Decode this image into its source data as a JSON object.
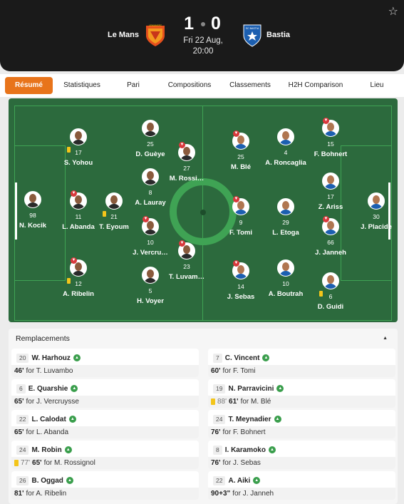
{
  "header": {
    "home_team": "Le Mans",
    "away_team": "Bastia",
    "home_score": "1",
    "away_score": "0",
    "date": "Fri 22 Aug,",
    "time": "20:00",
    "home_crest_text": "LEMANSFC",
    "away_crest_text": "SC BASTIA"
  },
  "tabs": [
    {
      "label": "Résumé"
    },
    {
      "label": "Statistiques"
    },
    {
      "label": "Pari"
    },
    {
      "label": "Compositions"
    },
    {
      "label": "Classements"
    },
    {
      "label": "H2H Comparison"
    },
    {
      "label": "Lieu"
    }
  ],
  "colors": {
    "accent": "#e8741b",
    "pitch": "#2c6a3d",
    "pitch_lines": "#3fa354",
    "sub_in": "#3a9e4c",
    "sub_out": "#d9393c",
    "yellow_card": "#f3c51a"
  },
  "lineup": {
    "home": [
      {
        "number": "98",
        "name": "N. Kocik",
        "sub_off": false,
        "yellow": false
      },
      {
        "number": "17",
        "name": "S. Yohou",
        "sub_off": false,
        "yellow": true
      },
      {
        "number": "11",
        "name": "L. Abanda",
        "sub_off": true,
        "yellow": false
      },
      {
        "number": "21",
        "name": "T. Eyoum",
        "sub_off": false,
        "yellow": true
      },
      {
        "number": "12",
        "name": "A. Ribelin",
        "sub_off": true,
        "yellow": true
      },
      {
        "number": "25",
        "name": "D. Guèye",
        "sub_off": false,
        "yellow": false
      },
      {
        "number": "8",
        "name": "A. Lauray",
        "sub_off": false,
        "yellow": false
      },
      {
        "number": "10",
        "name": "J. Vercru…",
        "sub_off": true,
        "yellow": false
      },
      {
        "number": "5",
        "name": "H. Voyer",
        "sub_off": false,
        "yellow": false
      },
      {
        "number": "27",
        "name": "M. Rossi…",
        "sub_off": true,
        "yellow": false
      },
      {
        "number": "23",
        "name": "T. Luvam…",
        "sub_off": true,
        "yellow": false
      }
    ],
    "away": [
      {
        "number": "30",
        "name": "J. Placide",
        "sub_off": false,
        "yellow": false
      },
      {
        "number": "15",
        "name": "F. Bohnert",
        "sub_off": true,
        "yellow": false
      },
      {
        "number": "17",
        "name": "Z. Ariss",
        "sub_off": false,
        "yellow": false
      },
      {
        "number": "66",
        "name": "J. Janneh",
        "sub_off": true,
        "yellow": false
      },
      {
        "number": "6",
        "name": "D. Guidi",
        "sub_off": false,
        "yellow": true
      },
      {
        "number": "4",
        "name": "A. Roncaglia",
        "sub_off": false,
        "yellow": false
      },
      {
        "number": "29",
        "name": "L. Etoga",
        "sub_off": false,
        "yellow": false
      },
      {
        "number": "10",
        "name": "A. Boutrah",
        "sub_off": false,
        "yellow": false
      },
      {
        "number": "25",
        "name": "M. Blé",
        "sub_off": true,
        "yellow": false
      },
      {
        "number": "9",
        "name": "F. Tomi",
        "sub_off": true,
        "yellow": false
      },
      {
        "number": "14",
        "name": "J. Sebas",
        "sub_off": true,
        "yellow": false
      }
    ]
  },
  "substitutions": {
    "title": "Remplacements",
    "home": [
      {
        "number": "20",
        "name": "W. Harhouz",
        "minute": "46'",
        "for": "for T. Luvambo"
      },
      {
        "number": "6",
        "name": "E. Quarshie",
        "minute": "65'",
        "for": "for J. Vercruysse"
      },
      {
        "number": "22",
        "name": "L. Calodat",
        "minute": "65'",
        "for": "for L. Abanda"
      },
      {
        "number": "24",
        "name": "M. Robin",
        "card_minute": "77'",
        "minute": "65'",
        "for": "for M. Rossignol"
      },
      {
        "number": "26",
        "name": "B. Oggad",
        "minute": "81'",
        "for": "for A. Ribelin"
      }
    ],
    "away": [
      {
        "number": "7",
        "name": "C. Vincent",
        "minute": "60'",
        "for": "for F. Tomi"
      },
      {
        "number": "19",
        "name": "N. Parravicini",
        "card_minute": "88'",
        "minute": "61'",
        "for": "for M. Blé"
      },
      {
        "number": "24",
        "name": "T. Meynadier",
        "minute": "76'",
        "for": "for F. Bohnert"
      },
      {
        "number": "8",
        "name": "I. Karamoko",
        "minute": "76'",
        "for": "for J. Sebas"
      },
      {
        "number": "22",
        "name": "A. Aiki",
        "minute": "90+3\"",
        "for": "for J. Janneh"
      }
    ]
  }
}
